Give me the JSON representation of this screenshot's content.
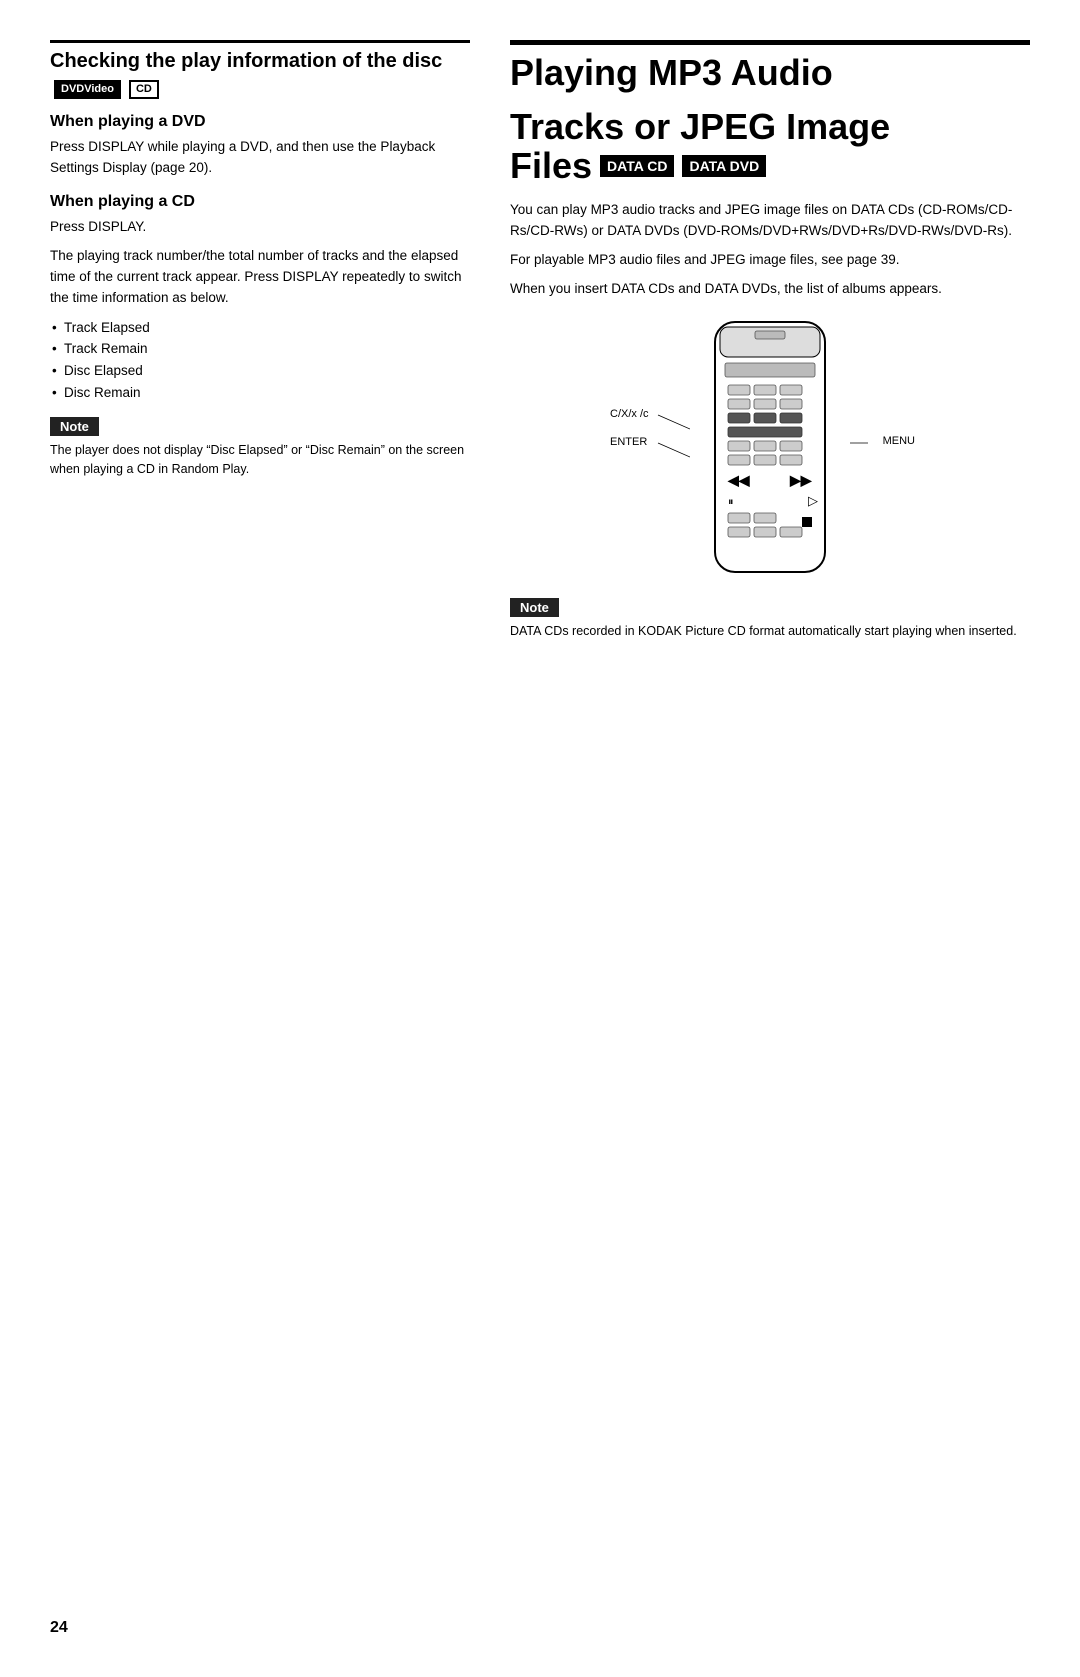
{
  "page_number": "24",
  "left": {
    "section_title": "Checking the play information of the disc",
    "badges_title": [
      "DVDVideo",
      "CD"
    ],
    "subsections": [
      {
        "heading": "When playing a DVD",
        "body": "Press DISPLAY while playing a DVD, and then use the Playback Settings Display (page 20)."
      },
      {
        "heading": "When playing a CD",
        "intro": "Press DISPLAY.",
        "body": "The playing track number/the total number of tracks and the elapsed time of the current track appear. Press DISPLAY repeatedly to switch the time information as below.",
        "bullets": [
          "Track Elapsed",
          "Track Remain",
          "Disc Elapsed",
          "Disc Remain"
        ]
      }
    ],
    "note": {
      "label": "Note",
      "text": "The player does not display “Disc Elapsed” or “Disc Remain” on the screen when playing a CD in Random Play."
    }
  },
  "right": {
    "section_title_line1": "Playing MP3 Audio",
    "section_title_line2": "Tracks or JPEG Image",
    "section_title_line3": "Files",
    "badges_files": [
      "DATA CD",
      "DATA DVD"
    ],
    "body1": "You can play MP3 audio tracks and JPEG image files on DATA CDs  (CD-ROMs/CD-Rs/CD-RWs) or DATA DVDs (DVD-ROMs/DVD+RWs/DVD+Rs/DVD-RWs/DVD-Rs).",
    "body2": "For playable MP3 audio files and JPEG image files, see page 39.",
    "body3": "When you insert DATA CDs and DATA DVDs, the list of albums appears.",
    "remote_labels": {
      "cx_label": "C/X/x /c",
      "enter_label": "ENTER",
      "menu_label": "MENU"
    },
    "note": {
      "label": "Note",
      "text": "DATA CDs recorded in KODAK Picture CD format automatically start playing when inserted."
    }
  }
}
